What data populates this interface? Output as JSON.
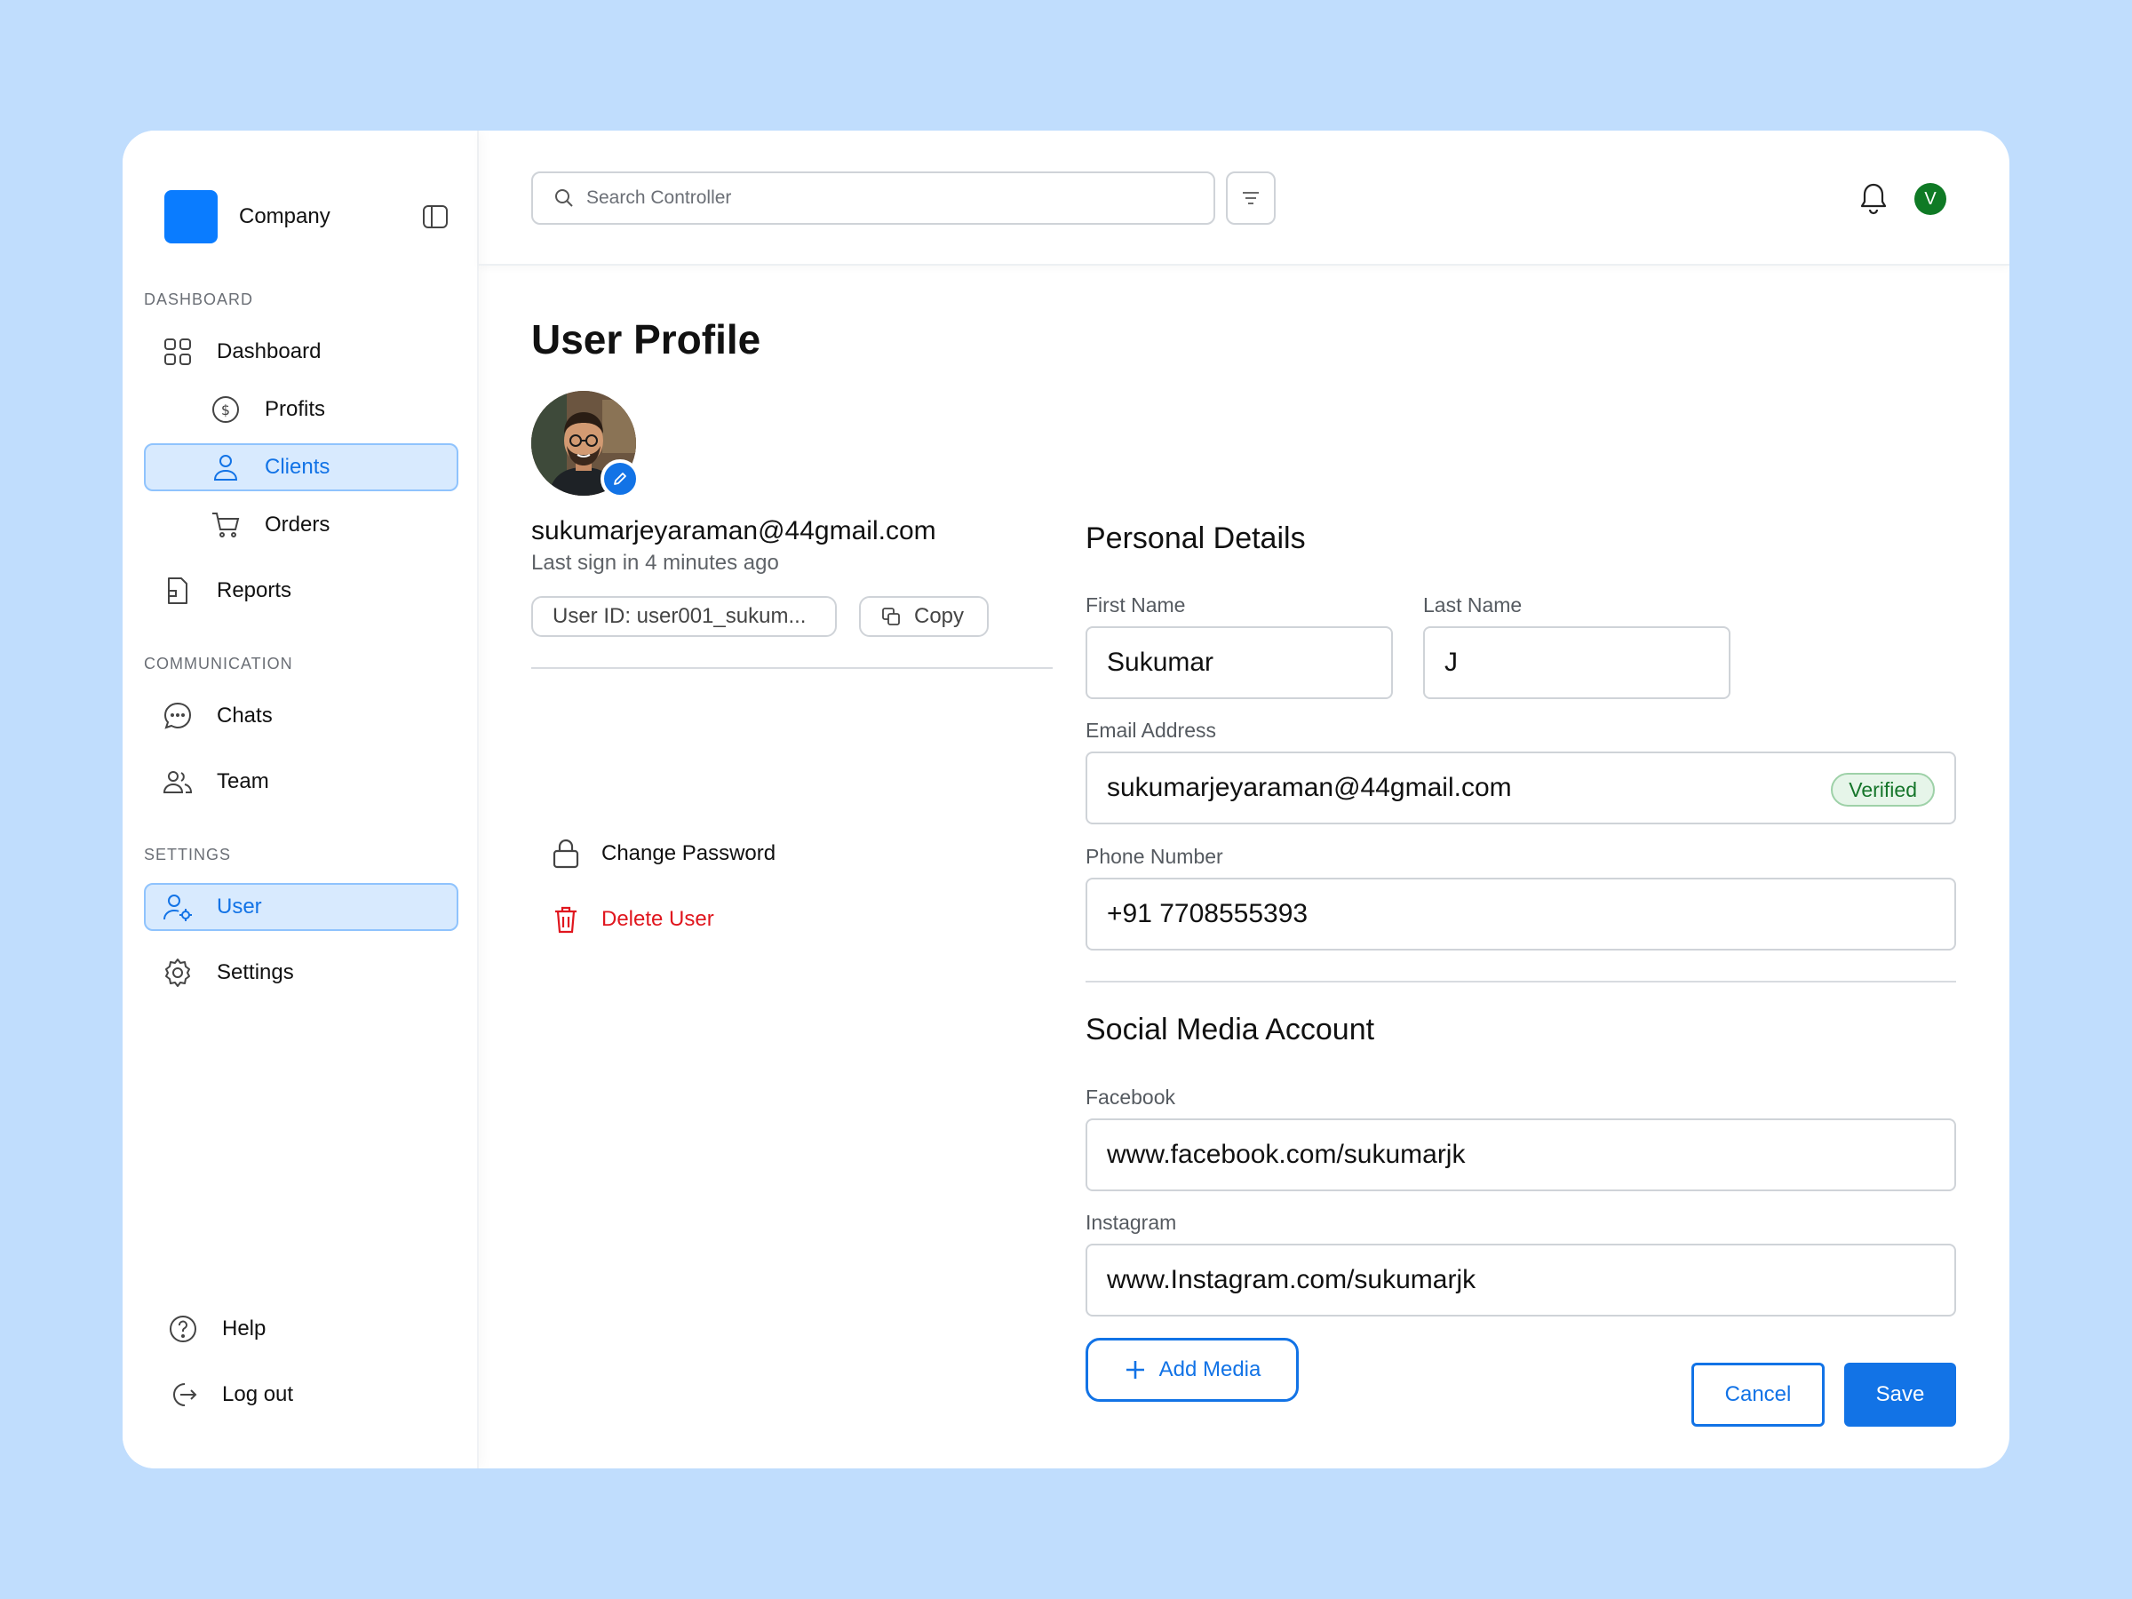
{
  "brand": {
    "name": "Company",
    "logo_color": "#0a7cff"
  },
  "sidebar": {
    "sections": {
      "dashboard": "DASHBOARD",
      "communication": "COMMUNICATION",
      "settings": "SETTINGS"
    },
    "items": {
      "dashboard": "Dashboard",
      "profits": "Profits",
      "clients": "Clients",
      "orders": "Orders",
      "reports": "Reports",
      "chats": "Chats",
      "team": "Team",
      "user": "User",
      "settings": "Settings",
      "help": "Help",
      "logout": "Log out"
    },
    "active_items": [
      "Clients",
      "User"
    ]
  },
  "topbar": {
    "search_placeholder": "Search Controller",
    "avatar_initial": "V"
  },
  "page": {
    "title": "User Profile",
    "profile": {
      "email": "sukumarjeyaraman@44gmail.com",
      "last_sign": "Last sign in 4 minutes ago",
      "user_id": "User ID: user001_sukum...",
      "copy_label": "Copy"
    },
    "actions": {
      "change_password": "Change Password",
      "delete_user": "Delete User"
    },
    "personal": {
      "title": "Personal Details",
      "first_name_label": "First Name",
      "first_name": "Sukumar",
      "last_name_label": "Last Name",
      "last_name": "J",
      "email_label": "Email Address",
      "email": "sukumarjeyaraman@44gmail.com",
      "verified_badge": "Verified",
      "phone_label": "Phone Number",
      "phone": "+91 7708555393"
    },
    "social": {
      "title": "Social Media Account",
      "facebook_label": "Facebook",
      "facebook": "www.facebook.com/sukumarjk",
      "instagram_label": "Instagram",
      "instagram": "www.Instagram.com/sukumarjk",
      "add_media": "Add Media"
    },
    "buttons": {
      "cancel": "Cancel",
      "save": "Save"
    }
  },
  "colors": {
    "background": "#c0ddfd",
    "accent": "#1273e6",
    "danger": "#e0161e",
    "success": "#15752a",
    "active_bg": "#d8eafe"
  }
}
